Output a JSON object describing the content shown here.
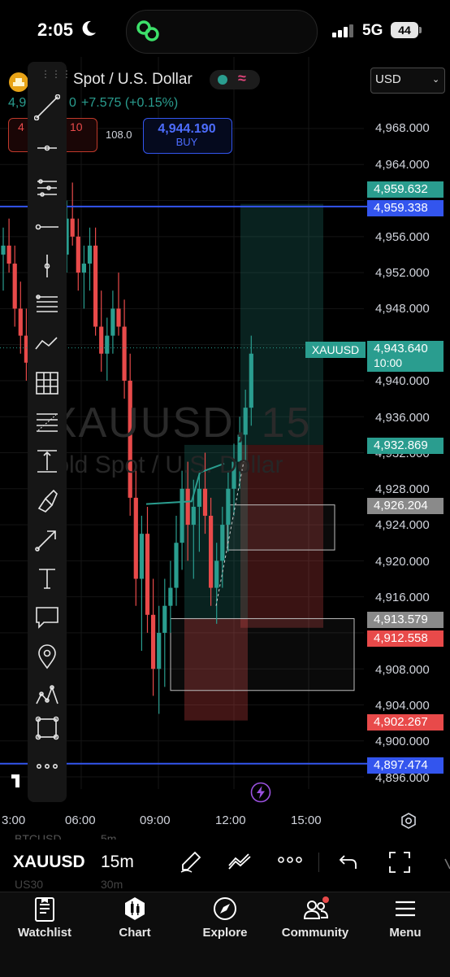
{
  "status_bar": {
    "time": "2:05",
    "network": "5G",
    "battery": "44"
  },
  "header": {
    "symbol_title": "Spot / U.S. Dollar",
    "currency": "USD",
    "price_prefix": "4,9",
    "price_suffix": "0",
    "price_change": "+7.575 (+0.15%)",
    "sell_price": "4",
    "sell_price_suffix": "10",
    "spread": "108.0",
    "buy_price": "4,944.190",
    "buy_label": "BUY"
  },
  "watermark": {
    "line1": "XAUUSD, 15",
    "line2": "Gold Spot / U.S. Dollar"
  },
  "price_axis": {
    "ticks": [
      "4,968.000",
      "4,964.000",
      "4,956.000",
      "4,952.000",
      "4,948.000",
      "4,940.000",
      "4,936.000",
      "4,932.000",
      "4,928.000",
      "4,924.000",
      "4,920.000",
      "4,916.000",
      "4,908.000",
      "4,904.000",
      "4,900.000",
      "4,896.000"
    ],
    "tags": [
      {
        "price": "4,959.632",
        "color": "#2a9d8f"
      },
      {
        "price": "4,959.338",
        "color": "#3355ee"
      },
      {
        "price": "4,932.869",
        "color": "#2a9d8f"
      },
      {
        "price": "4,926.204",
        "color": "#8a8a8a"
      },
      {
        "price": "4,913.579",
        "color": "#8a8a8a"
      },
      {
        "price": "4,912.558",
        "color": "#e84a4a"
      },
      {
        "price": "4,902.267",
        "color": "#e84a4a"
      },
      {
        "price": "4,897.474",
        "color": "#3355ee"
      }
    ],
    "symbol_tag": "XAUUSD",
    "last_price": "4,943.640",
    "countdown": "10:00"
  },
  "time_axis": [
    "3:00",
    "06:00",
    "09:00",
    "12:00",
    "15:00"
  ],
  "drawing_tools": [
    "trend-line",
    "horizontal-ray",
    "pitchfork",
    "horizontal-line",
    "vertical-line",
    "parallel-channel",
    "path",
    "gann-grid",
    "fib-retracement",
    "long-position",
    "brush",
    "arrow",
    "text",
    "callout",
    "pin",
    "pattern",
    "rectangle",
    "more"
  ],
  "bottom_toolbar": {
    "symbol": "XAUUSD",
    "interval": "15m",
    "bg_symbol_1": "BTCUSD",
    "bg_interval_1": "5m",
    "bg_symbol_2": "US30",
    "bg_interval_2": "30m"
  },
  "tabs": [
    {
      "label": "Watchlist",
      "icon": "watchlist-icon"
    },
    {
      "label": "Chart",
      "icon": "chart-icon"
    },
    {
      "label": "Explore",
      "icon": "compass-icon"
    },
    {
      "label": "Community",
      "icon": "community-icon"
    },
    {
      "label": "Menu",
      "icon": "menu-icon"
    }
  ],
  "colors": {
    "bull": "#2a9d8f",
    "bear": "#e84a4a",
    "accent": "#3355ee"
  },
  "chart_data": {
    "type": "candlestick",
    "symbol": "XAUUSD",
    "interval": "15m",
    "ylim": [
      4895,
      4972
    ],
    "horizontal_lines": [
      4959.338,
      4897.474
    ],
    "candles": [
      [
        4954,
        4957,
        4950,
        4955
      ],
      [
        4955,
        4958,
        4952,
        4953
      ],
      [
        4953,
        4955,
        4946,
        4948
      ],
      [
        4948,
        4951,
        4943,
        4945
      ],
      [
        4945,
        4948,
        4940,
        4942
      ],
      [
        4942,
        4947,
        4939,
        4946
      ],
      [
        4946,
        4952,
        4944,
        4950
      ],
      [
        4950,
        4954,
        4948,
        4952
      ],
      [
        4952,
        4955,
        4947,
        4949
      ],
      [
        4949,
        4953,
        4946,
        4951
      ],
      [
        4951,
        4956,
        4949,
        4954
      ],
      [
        4954,
        4960,
        4952,
        4958
      ],
      [
        4958,
        4962,
        4955,
        4956
      ],
      [
        4956,
        4958,
        4950,
        4952
      ],
      [
        4952,
        4955,
        4948,
        4953
      ],
      [
        4953,
        4957,
        4950,
        4955
      ],
      [
        4955,
        4957,
        4945,
        4946
      ],
      [
        4946,
        4950,
        4941,
        4943
      ],
      [
        4943,
        4947,
        4940,
        4945
      ],
      [
        4945,
        4950,
        4943,
        4948
      ],
      [
        4948,
        4952,
        4945,
        4946
      ],
      [
        4946,
        4949,
        4938,
        4940
      ],
      [
        4940,
        4943,
        4925,
        4927
      ],
      [
        4927,
        4930,
        4915,
        4918
      ],
      [
        4918,
        4925,
        4910,
        4923
      ],
      [
        4923,
        4926,
        4912,
        4914
      ],
      [
        4914,
        4918,
        4905,
        4908
      ],
      [
        4908,
        4915,
        4903,
        4912
      ],
      [
        4912,
        4918,
        4906,
        4915
      ],
      [
        4915,
        4920,
        4912,
        4917
      ],
      [
        4917,
        4925,
        4915,
        4922
      ],
      [
        4922,
        4930,
        4919,
        4928
      ],
      [
        4928,
        4931,
        4920,
        4924
      ],
      [
        4924,
        4929,
        4918,
        4926
      ],
      [
        4926,
        4930,
        4921,
        4928
      ],
      [
        4928,
        4932,
        4923,
        4925
      ],
      [
        4925,
        4927,
        4915,
        4917
      ],
      [
        4917,
        4922,
        4913,
        4920
      ],
      [
        4920,
        4926,
        4917,
        4924
      ],
      [
        4924,
        4930,
        4921,
        4928
      ],
      [
        4928,
        4933,
        4925,
        4931
      ],
      [
        4931,
        4936,
        4928,
        4934
      ],
      [
        4934,
        4939,
        4931,
        4937
      ],
      [
        4937,
        4945,
        4935,
        4943
      ]
    ]
  }
}
